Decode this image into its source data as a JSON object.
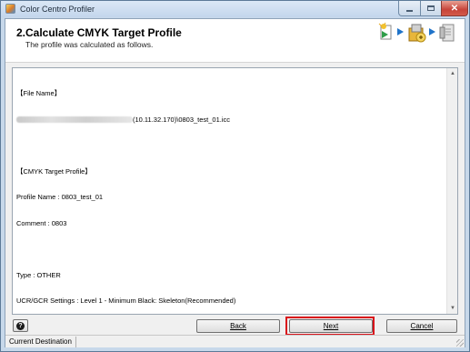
{
  "window": {
    "title": "Color Centro Profiler",
    "minimize": "",
    "maximize": "",
    "close": "✕"
  },
  "header": {
    "title": "2.Calculate CMYK Target Profile",
    "subtitle": "The profile was calculated as follows.",
    "step_icons": [
      "wizard-step-icon",
      "arrow-right-icon",
      "profile-calculate-icon",
      "arrow-right-icon",
      "finish-icon"
    ]
  },
  "content": {
    "file_name_heading": "【File Name】",
    "file_path_visible": "(10.11.32.170)\\0803_test_01.icc",
    "cmyk_heading": "【CMYK Target Profile】",
    "profile_name": "Profile Name : 0803_test_01",
    "comment": "Comment : 0803",
    "type": "Type : OTHER",
    "ucr_gcr": "UCR/GCR Settings : Level 1 - Minimum Black: Skeleton(Recommended)"
  },
  "buttons": {
    "help": "?",
    "back": "Back",
    "next": "Next",
    "cancel": "Cancel"
  },
  "status": {
    "text": "Current Destination"
  },
  "colors": {
    "highlight": "#d9141b",
    "frame": "#c7d8ea"
  }
}
